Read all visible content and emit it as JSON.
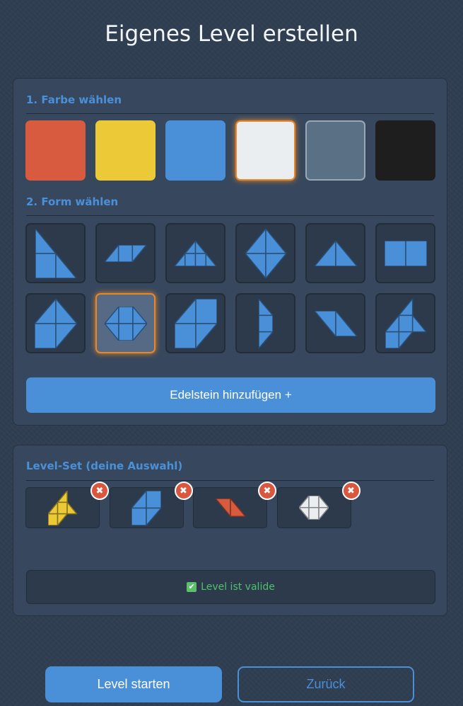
{
  "title": "Eigenes Level erstellen",
  "colors_section": {
    "heading": "1. Farbe wählen",
    "swatches": [
      {
        "name": "red",
        "hex": "#d95b3f"
      },
      {
        "name": "yellow",
        "hex": "#ecc936"
      },
      {
        "name": "blue",
        "hex": "#4a90d9"
      },
      {
        "name": "white",
        "hex": "#ebeef0",
        "selected": true
      },
      {
        "name": "gray",
        "hex": "#5a7085"
      },
      {
        "name": "black",
        "hex": "#1e1e1e"
      }
    ]
  },
  "shapes_section": {
    "heading": "2. Form wählen",
    "shapes": [
      "right-triangle",
      "parallelogram",
      "trapezoid-triangle",
      "diamond",
      "triangle",
      "rectangle",
      "house",
      "hexagon",
      "tilted-box",
      "arrow-bar",
      "slanted-parallelogram",
      "bird"
    ],
    "selected_shape": "hexagon",
    "add_button": "Edelstein hinzufügen +"
  },
  "level_set": {
    "heading": "Level-Set (deine Auswahl)",
    "items": [
      {
        "shape": "bird",
        "color": "#ecc936"
      },
      {
        "shape": "tilted-box",
        "color": "#4a90d9"
      },
      {
        "shape": "slanted-parallelogram",
        "color": "#d95b3f"
      },
      {
        "shape": "hexagon",
        "color": "#ebeef0"
      }
    ],
    "remove_label": "✖",
    "status_icon": "check-icon",
    "status_text": "Level ist valide",
    "status_check": "✔"
  },
  "buttons": {
    "start": "Level starten",
    "back": "Zurück"
  }
}
